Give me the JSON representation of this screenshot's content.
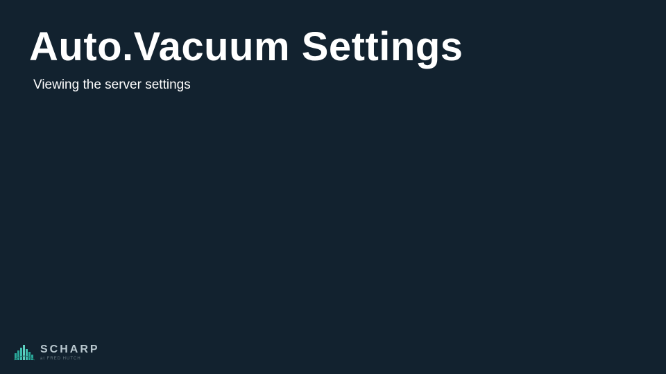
{
  "slide": {
    "title": "Auto.Vacuum Settings",
    "subtitle": "Viewing the server settings"
  },
  "logo": {
    "name": "SCHARP",
    "tagline": "at FRED HUTCH"
  }
}
